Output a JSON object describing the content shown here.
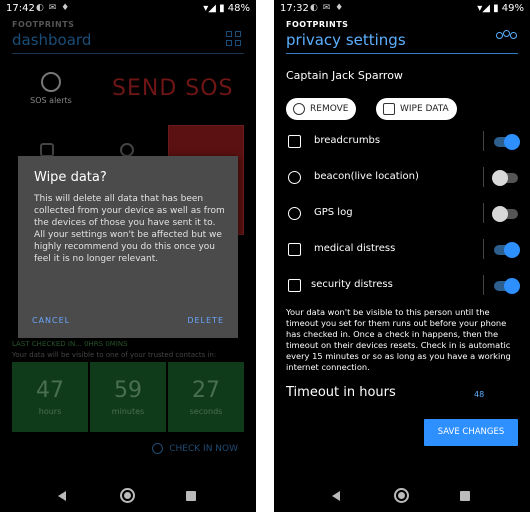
{
  "screen_left": {
    "status": {
      "time": "17:42",
      "battery": "48%"
    },
    "brand": "FOOTPRINTS",
    "title": "dashboard",
    "tiles": {
      "sos_alerts": "SOS alerts",
      "send_sos": "SEND SOS"
    },
    "checkin": {
      "last_checked": "LAST CHECKED IN... 0HRS 0MINS",
      "note": "Your data will be visible to one of your trusted contacts in:",
      "counters": [
        {
          "value": "47",
          "unit": "hours"
        },
        {
          "value": "59",
          "unit": "minutes"
        },
        {
          "value": "27",
          "unit": "seconds"
        }
      ],
      "check_in_now": "CHECK IN NOW"
    },
    "dialog": {
      "title": "Wipe data?",
      "message": "This will delete all data that has been collected from your device as well as from the devices of those you have sent it to.",
      "message2": "All your settings won't be affected but we highly recommend you do this once you feel it is no longer relevant.",
      "cancel": "CANCEL",
      "delete": "DELETE"
    }
  },
  "screen_right": {
    "status": {
      "time": "17:32",
      "battery": "49%"
    },
    "brand": "FOOTPRINTS",
    "title": "privacy settings",
    "contact_name": "Captain Jack Sparrow",
    "buttons": {
      "remove": "REMOVE",
      "wipe": "WIPE DATA"
    },
    "settings": [
      {
        "label": "breadcrumbs",
        "on": true
      },
      {
        "label": "beacon(live location)",
        "on": false
      },
      {
        "label": "GPS log",
        "on": false
      },
      {
        "label": "medical distress",
        "on": true
      },
      {
        "label": "security distress",
        "on": true
      }
    ],
    "info": "Your data won't be visible to this person until the timeout you set for them runs out before your phone has checked in. Once a check in happens, then the timeout on their devices resets. Check in is automatic every 15 minutes or so as long as you have a working internet connection.",
    "timeout_label": "Timeout in hours",
    "timeout_value": "48",
    "save": "SAVE CHANGES"
  },
  "colors": {
    "accent": "#2e8fff",
    "sos_red": "#6e1515",
    "dialog_bg": "#4b4b4b"
  }
}
